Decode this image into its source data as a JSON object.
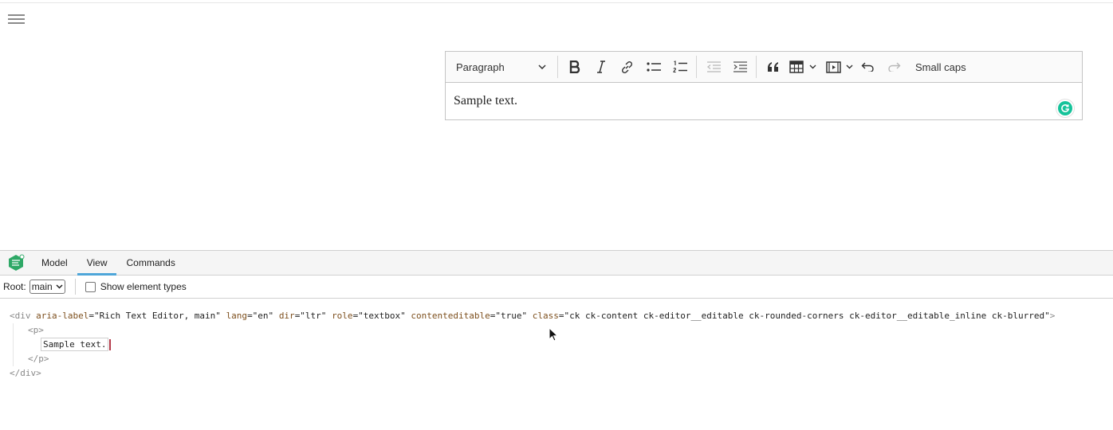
{
  "editor": {
    "toolbar": {
      "heading_dropdown": "Paragraph",
      "small_caps": "Small caps"
    },
    "content": "Sample text."
  },
  "inspector": {
    "tabs": [
      "Model",
      "View",
      "Commands"
    ],
    "active_tab": "View",
    "root_label": "Root:",
    "root_value": "main",
    "show_types_label": "Show element types",
    "tree": {
      "div_open": "<div",
      "attr1_name": "aria-label",
      "attr1_val": "=\"Rich Text Editor, main\"",
      "attr2_name": "lang",
      "attr2_val": "=\"en\"",
      "attr3_name": "dir",
      "attr3_val": "=\"ltr\"",
      "attr4_name": "role",
      "attr4_val": "=\"textbox\"",
      "attr5_name": "contenteditable",
      "attr5_val": "=\"true\"",
      "attr6_name": "class",
      "attr6_val": "=\"ck ck-content ck-editor__editable ck-rounded-corners ck-editor__editable_inline ck-blurred\"",
      "div_open_end": ">",
      "p_open": "<p>",
      "text": "Sample text.",
      "p_close": "</p>",
      "div_close": "</div>"
    }
  },
  "colors": {
    "accent_tab": "#4ea6d9",
    "grammarly": "#15c39a",
    "attr_name": "#7d4f1d",
    "cursor": "#b43a4a"
  }
}
